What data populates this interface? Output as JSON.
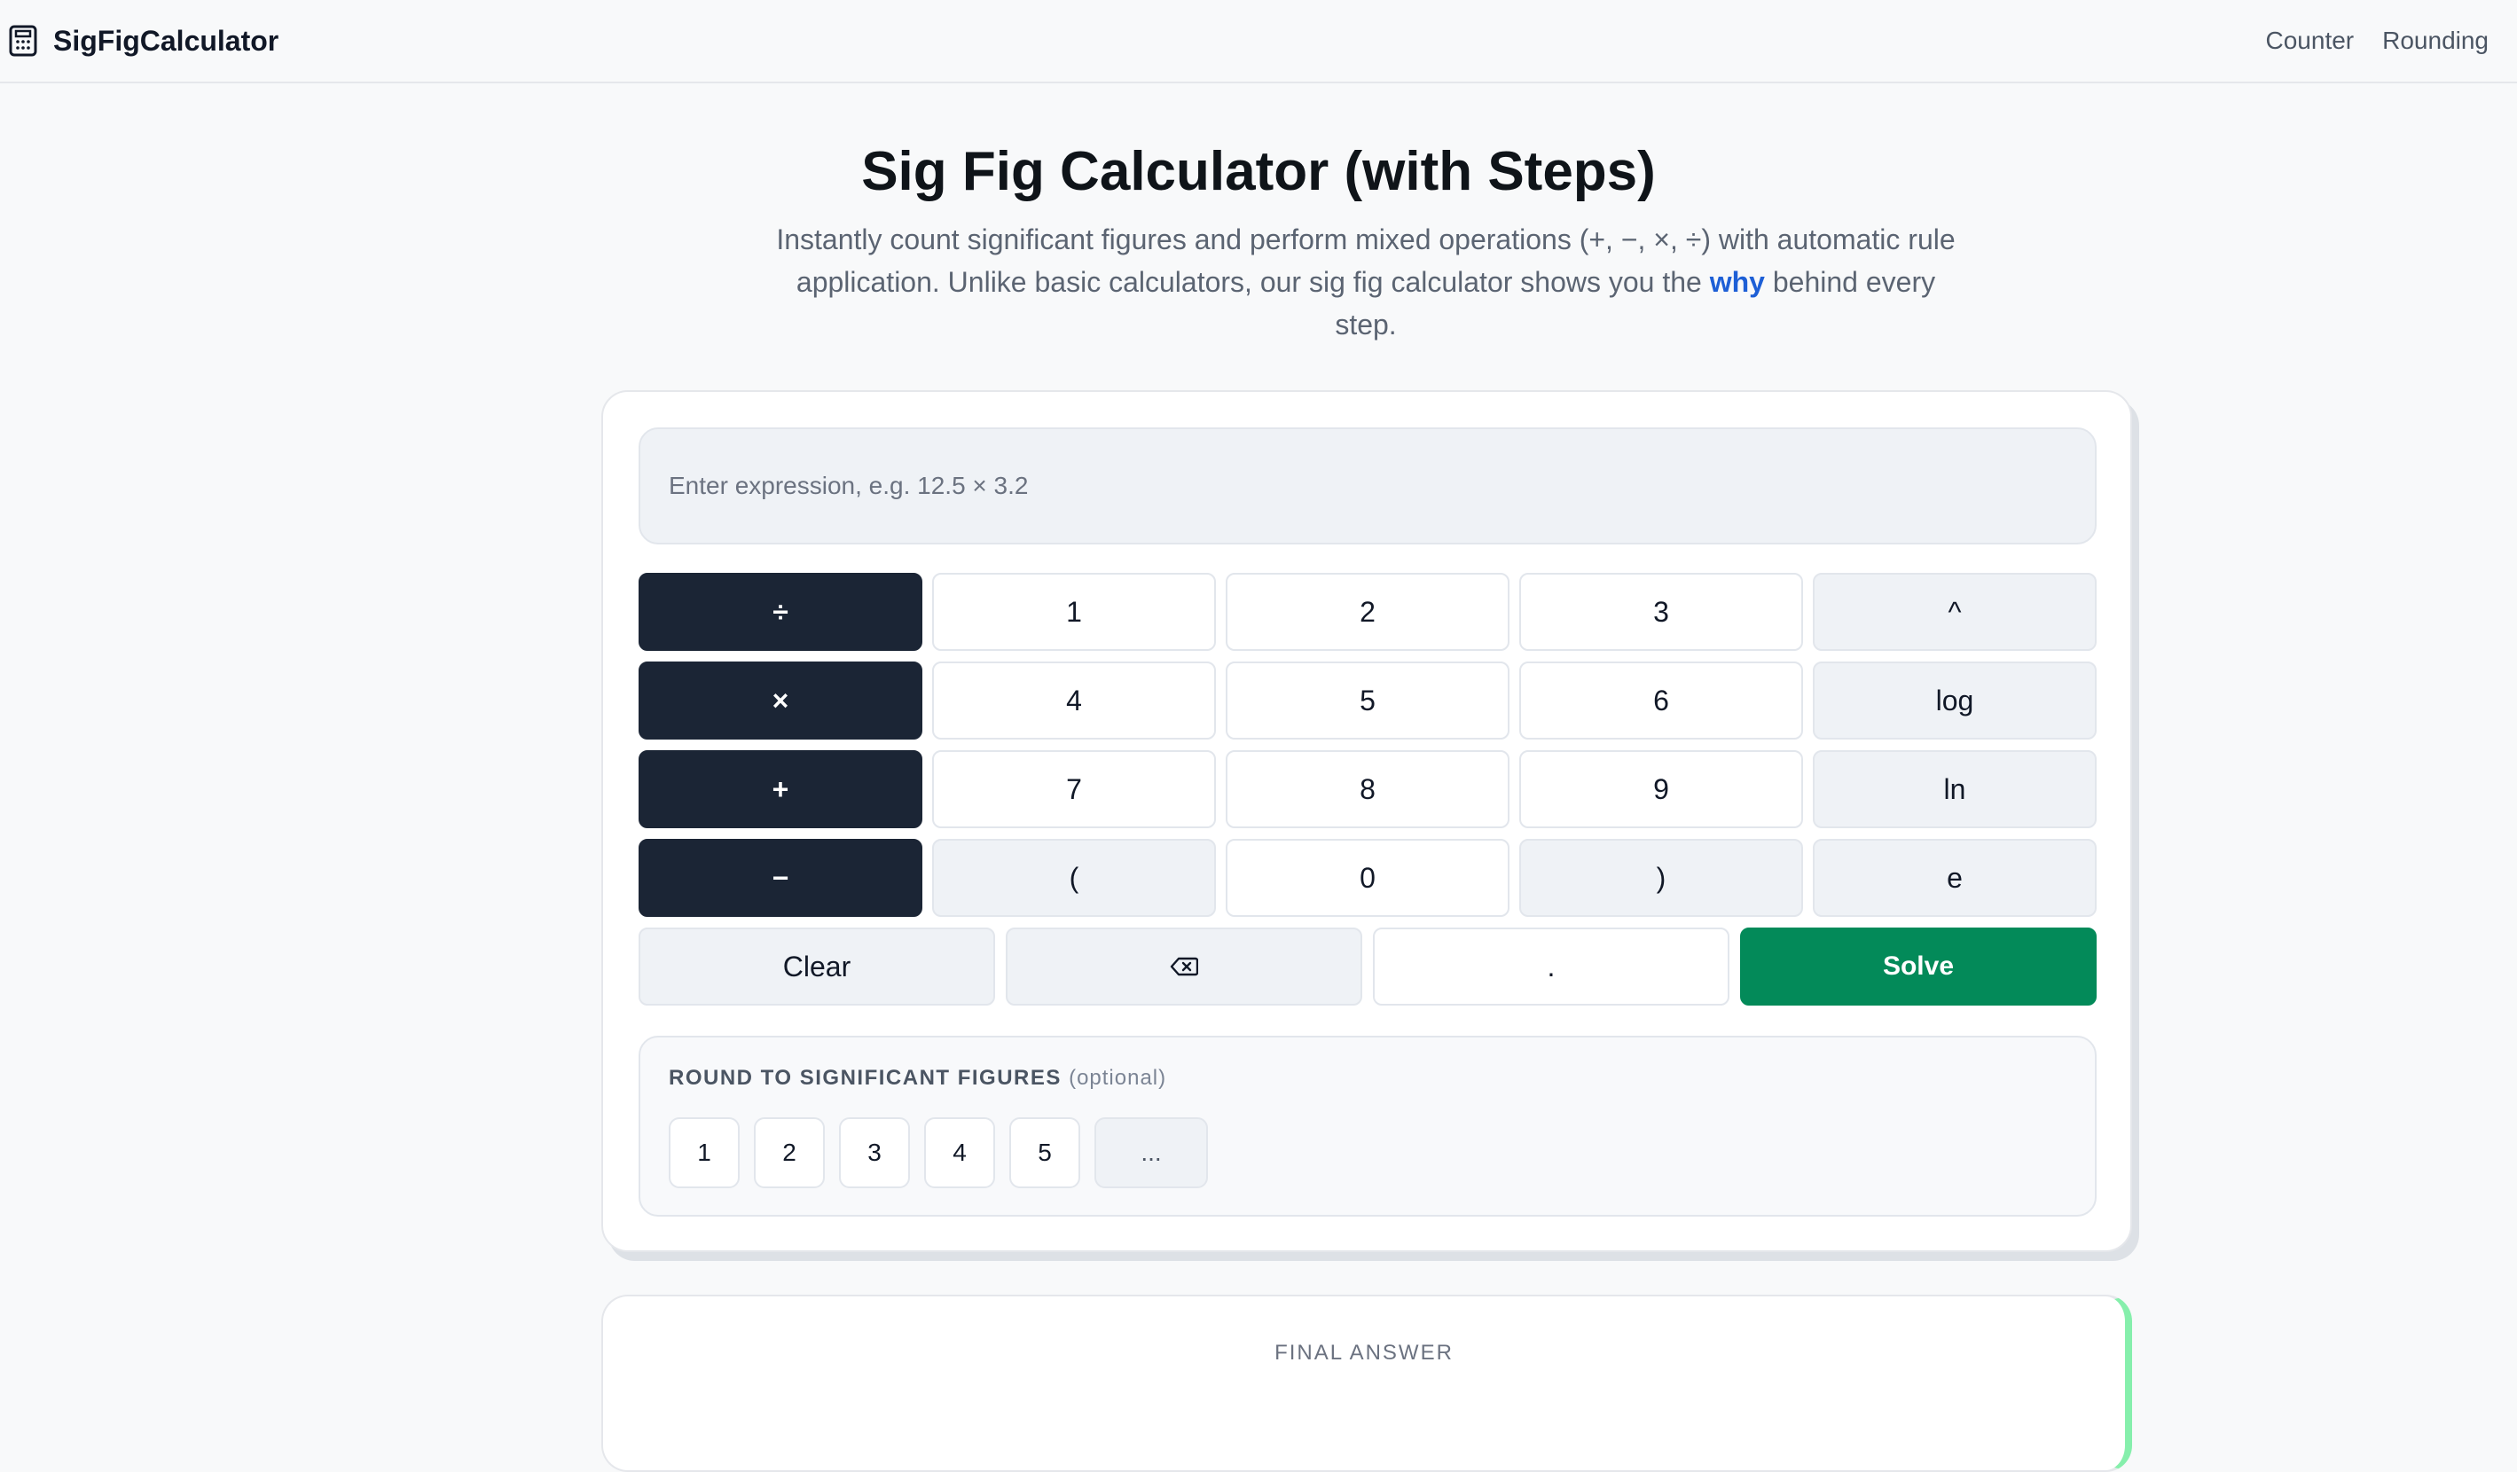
{
  "header": {
    "brand": "SigFigCalculator",
    "nav": [
      "Counter",
      "Rounding"
    ]
  },
  "hero": {
    "title": "Sig Fig Calculator (with Steps)",
    "subtitle_before": "Instantly count significant figures and perform mixed operations (+, −, ×, ÷) with automatic rule application. Unlike basic calculators, our sig fig calculator shows you the ",
    "subtitle_highlight": "why",
    "subtitle_after": " behind every step."
  },
  "calculator": {
    "input_placeholder": "Enter expression, e.g. 12.5 × 3.2",
    "input_value": "",
    "keys": {
      "div": "÷",
      "mul": "×",
      "add": "+",
      "sub": "−",
      "k1": "1",
      "k2": "2",
      "k3": "3",
      "k4": "4",
      "k5": "5",
      "k6": "6",
      "k7": "7",
      "k8": "8",
      "k9": "9",
      "lparen": "(",
      "k0": "0",
      "rparen": ")",
      "pow": "^",
      "log": "log",
      "ln": "ln",
      "e": "e",
      "clear": "Clear",
      "dot": ".",
      "solve": "Solve"
    },
    "backspace_icon": "backspace-icon"
  },
  "rounding": {
    "label": "ROUND TO SIGNIFICANT FIGURES",
    "optional": "(optional)",
    "options": [
      "1",
      "2",
      "3",
      "4",
      "5"
    ],
    "more": "..."
  },
  "result": {
    "label": "FINAL ANSWER"
  },
  "colors": {
    "operator_key": "#1b2535",
    "solve_key": "#038a59",
    "link_accent": "#1d5fd6"
  }
}
